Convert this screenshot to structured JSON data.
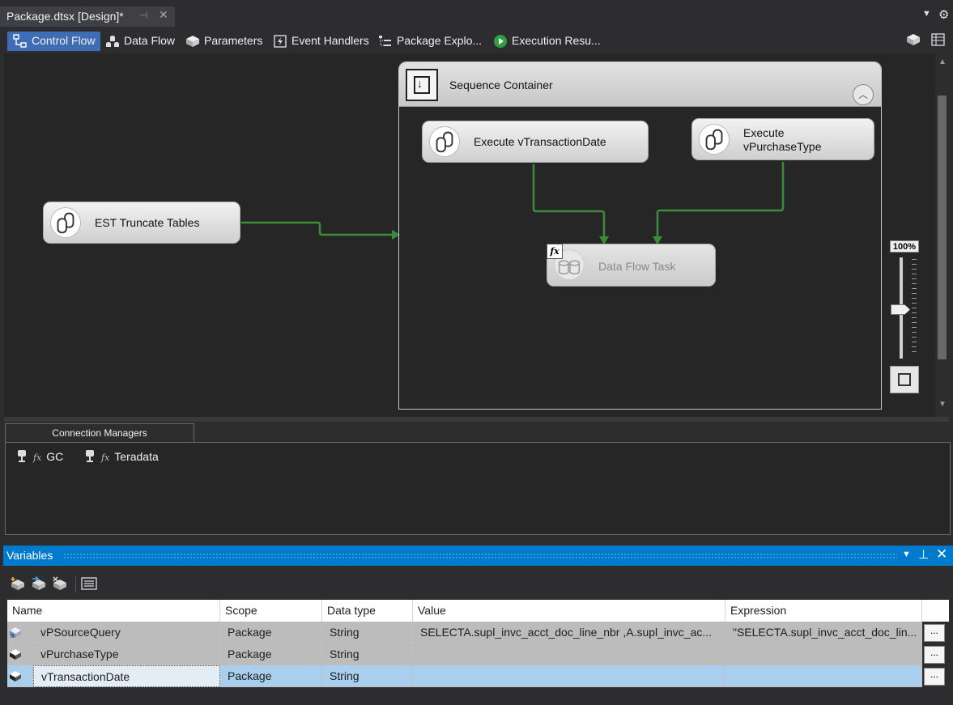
{
  "document_tab": {
    "title": "Package.dtsx [Design]*",
    "pin": "⊣",
    "close": "✕"
  },
  "designer_tabs": [
    {
      "label": "Control Flow",
      "icon": "control-flow-icon"
    },
    {
      "label": "Data Flow",
      "icon": "data-flow-icon"
    },
    {
      "label": "Parameters",
      "icon": "parameters-icon"
    },
    {
      "label": "Event Handlers",
      "icon": "event-handlers-icon"
    },
    {
      "label": "Package Explo...",
      "icon": "package-explorer-icon"
    },
    {
      "label": "Execution Resu...",
      "icon": "execution-results-icon"
    }
  ],
  "active_tab": "Control Flow",
  "canvas": {
    "sequence_container": {
      "title": "Sequence Container"
    },
    "tasks": {
      "truncate": "EST Truncate Tables",
      "tx_date": "Execute vTransactionDate",
      "purchase_type": "Execute\nvPurchaseType",
      "data_flow": "Data Flow Task"
    },
    "data_flow_badge": "fx",
    "zoom": "100%"
  },
  "connection_managers": {
    "tab_label": "Connection Managers",
    "items": [
      {
        "fx": "fx",
        "name": "GC"
      },
      {
        "fx": "fx",
        "name": "Teradata"
      }
    ]
  },
  "variables": {
    "title": "Variables",
    "columns": [
      "Name",
      "Scope",
      "Data type",
      "Value",
      "Expression"
    ],
    "rows": [
      {
        "name": "vPSourceQuery",
        "scope": "Package",
        "type": "String",
        "value": "SELECTA.supl_invc_acct_doc_line_nbr     ,A.supl_invc_ac...",
        "expression": "\"SELECTA.supl_invc_acct_doc_lin...",
        "button": "..."
      },
      {
        "name": "vPurchaseType",
        "scope": "Package",
        "type": "String",
        "value": "",
        "expression": "",
        "button": "..."
      },
      {
        "name": "vTransactionDate",
        "scope": "Package",
        "type": "String",
        "value": "",
        "expression": "",
        "button": "..."
      }
    ]
  },
  "colors": {
    "accent": "#007acc",
    "active_tab": "#3e6db5",
    "precedence": "#3c8c3c",
    "selected_row": "#aacfee"
  }
}
